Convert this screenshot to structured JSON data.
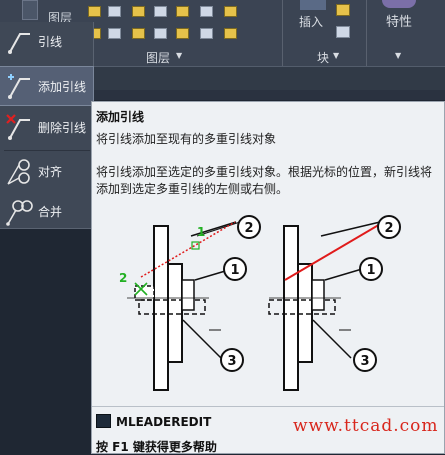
{
  "ribbon": {
    "layers_panel_label": "图层",
    "layers_panel_arrow": "▼",
    "layer_tab_partial": "图层",
    "insert_label": "插入",
    "block_panel_label": "块",
    "block_panel_arrow": "▼",
    "properties_label": "特性",
    "properties_arrow": "▼"
  },
  "menu": {
    "items": [
      {
        "label": "引线",
        "icon": "leader-icon"
      },
      {
        "label": "添加引线",
        "icon": "add-leader-icon",
        "active": true
      },
      {
        "label": "删除引线",
        "icon": "remove-leader-icon"
      },
      {
        "label": "对齐",
        "icon": "align-leaders-icon"
      },
      {
        "label": "合并",
        "icon": "collect-leaders-icon"
      }
    ]
  },
  "tooltip": {
    "title": "添加引线",
    "short_desc": "将引线添加至现有的多重引线对象",
    "long_desc": "将引线添加至选定的多重引线对象。根据光标的位置，新引线将添加到选定多重引线的左侧或右侧。",
    "command": "MLEADEREDIT",
    "help": "按 F1 键获得更多帮助",
    "diagram": {
      "step_labels": [
        "1",
        "2"
      ],
      "callouts": [
        "1",
        "2",
        "3",
        "1",
        "2",
        "3"
      ]
    }
  },
  "watermark": "www.ttcad.com",
  "colors": {
    "ribbon_bg": "#3b4453",
    "menu_bg": "#3f4856",
    "menu_active": "#556075",
    "tooltip_bg": "#eef1f4",
    "accent_red": "#e01b1b",
    "step_green": "#22b022",
    "watermark": "#d8261c"
  }
}
